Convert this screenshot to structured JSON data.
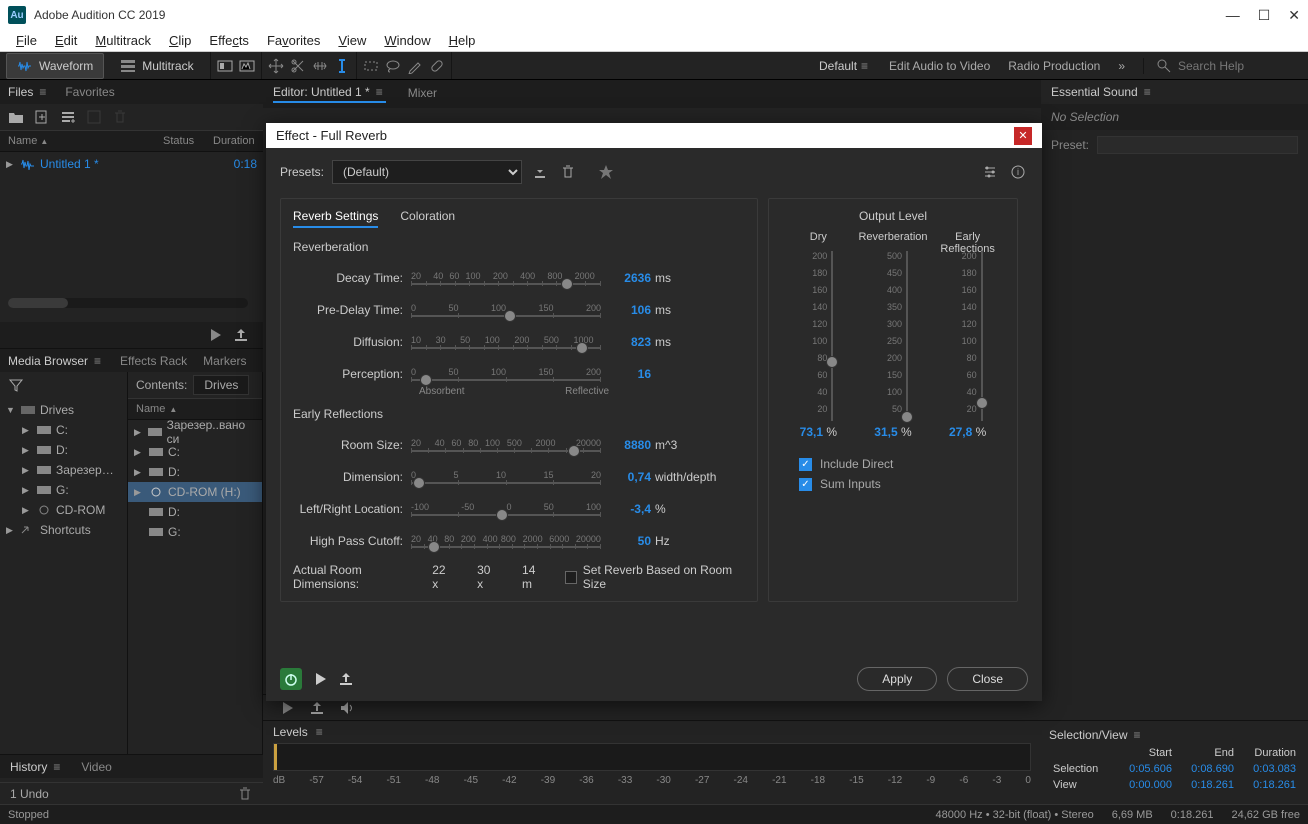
{
  "app": {
    "title": "Adobe Audition CC 2019",
    "logo_text": "Au"
  },
  "menu": [
    "File",
    "Edit",
    "Multitrack",
    "Clip",
    "Effects",
    "Favorites",
    "View",
    "Window",
    "Help"
  ],
  "toolbar": {
    "waveform": "Waveform",
    "multitrack": "Multitrack",
    "workspaces": {
      "default": "Default",
      "eav": "Edit Audio to Video",
      "radio": "Radio Production"
    },
    "search_placeholder": "Search Help"
  },
  "files": {
    "tab": "Files",
    "fav_tab": "Favorites",
    "cols": {
      "name": "Name",
      "status": "Status",
      "duration": "Duration"
    },
    "item": {
      "name": "Untitled 1 *",
      "dur": "0:18"
    }
  },
  "media": {
    "tab": "Media Browser",
    "effects_tab": "Effects Rack",
    "markers_tab": "Markers",
    "contents_label": "Contents:",
    "contents_value": "Drives",
    "name_col": "Name",
    "left_tree": [
      "Drives",
      "C:",
      "D:",
      "Зарезервировано",
      "G:",
      "CD-ROM",
      "Shortcuts"
    ],
    "right_tree": [
      "Зарезер..вано си",
      "C:",
      "D:",
      "CD-ROM (H:)",
      "D:",
      "G:"
    ]
  },
  "editor": {
    "tab": "Editor: Untitled 1 *",
    "mixer": "Mixer"
  },
  "dialog": {
    "title": "Effect - Full Reverb",
    "presets_label": "Presets:",
    "presets_value": "(Default)",
    "tabs": {
      "reverb": "Reverb Settings",
      "coloration": "Coloration"
    },
    "reverberation": "Reverberation",
    "decay": {
      "label": "Decay Time:",
      "ticks": [
        "20",
        "",
        "40",
        "60",
        "100",
        "",
        "200",
        "",
        "400",
        "",
        "800",
        "",
        "2000",
        ""
      ],
      "val": "2636",
      "unit": "ms",
      "pos": 82
    },
    "predelay": {
      "label": "Pre-Delay Time:",
      "ticks": [
        "0",
        "50",
        "100",
        "150",
        "200"
      ],
      "val": "106",
      "unit": "ms",
      "pos": 52
    },
    "diffusion": {
      "label": "Diffusion:",
      "ticks": [
        "10",
        "",
        "30",
        "",
        "50",
        "",
        "100",
        "",
        "200",
        "",
        "500",
        "",
        "1000",
        ""
      ],
      "val": "823",
      "unit": "ms",
      "pos": 90
    },
    "perception": {
      "label": "Perception:",
      "ticks": [
        "0",
        "50",
        "100",
        "150",
        "200"
      ],
      "val": "16",
      "unit": "",
      "pos": 8,
      "left": "Absorbent",
      "right": "Reflective"
    },
    "early": "Early Reflections",
    "room": {
      "label": "Room Size:",
      "ticks": [
        "20",
        "",
        "40",
        "60",
        "80",
        "100",
        "500",
        "",
        "2000",
        "",
        "",
        "20000"
      ],
      "val": "8880",
      "unit": "m^3",
      "pos": 86
    },
    "dim": {
      "label": "Dimension:",
      "ticks": [
        "0",
        "5",
        "10",
        "15",
        "20"
      ],
      "val": "0,74",
      "unit": "width/depth",
      "pos": 4
    },
    "lr": {
      "label": "Left/Right Location:",
      "ticks": [
        "-100",
        "-50",
        "0",
        "50",
        "100"
      ],
      "val": "-3,4",
      "unit": "%",
      "pos": 48
    },
    "hpc": {
      "label": "High Pass Cutoff:",
      "ticks": [
        "20",
        "",
        "40",
        "",
        "80",
        "",
        "200",
        "",
        "400",
        "800",
        "",
        "2000",
        "",
        "6000",
        "",
        "20000"
      ],
      "val": "50",
      "unit": "Hz",
      "pos": 12
    },
    "roomdim": {
      "label": "Actual Room Dimensions:",
      "x": "22 x",
      "y": "30 x",
      "z": "14 m",
      "check_label": "Set Reverb Based on Room Size"
    },
    "output": {
      "title": "Output Level",
      "dry": {
        "label": "Dry",
        "nums": [
          "200",
          "180",
          "160",
          "140",
          "120",
          "100",
          "80",
          "60",
          "40",
          "20",
          ""
        ],
        "val": "73,1",
        "pos": 62
      },
      "rev": {
        "label": "Reverberation",
        "nums": [
          "500",
          "450",
          "400",
          "350",
          "300",
          "250",
          "200",
          "150",
          "100",
          "50",
          ""
        ],
        "val": "31,5",
        "pos": 94
      },
      "er": {
        "label": "Early Reflections",
        "nums": [
          "200",
          "180",
          "160",
          "140",
          "120",
          "100",
          "80",
          "60",
          "40",
          "20",
          ""
        ],
        "val": "27,8",
        "pos": 86
      },
      "include": "Include Direct",
      "sum": "Sum  Inputs"
    },
    "apply": "Apply",
    "close": "Close"
  },
  "levels": {
    "title": "Levels",
    "scale": [
      "dB",
      "-57",
      "-54",
      "-51",
      "-48",
      "-45",
      "-42",
      "-39",
      "-36",
      "-33",
      "-30",
      "-27",
      "-24",
      "-21",
      "-18",
      "-15",
      "-12",
      "-9",
      "-6",
      "-3",
      "0"
    ]
  },
  "essential": {
    "title": "Essential Sound",
    "nosel": "No Selection",
    "preset": "Preset:"
  },
  "selview": {
    "title": "Selection/View",
    "cols": [
      "Start",
      "End",
      "Duration"
    ],
    "selection": {
      "label": "Selection",
      "start": "0:05.606",
      "end": "0:08.690",
      "dur": "0:03.083"
    },
    "view": {
      "label": "View",
      "start": "0:00.000",
      "end": "0:18.261",
      "dur": "0:18.261"
    }
  },
  "history": {
    "tab": "History",
    "video_tab": "Video",
    "undo": "1 Undo"
  },
  "status": {
    "state": "Stopped",
    "sr": "48000 Hz",
    "bits": "32-bit (float)",
    "ch": "Stereo",
    "size": "6,69 MB",
    "dur": "0:18.261",
    "free": "24,62 GB free"
  }
}
